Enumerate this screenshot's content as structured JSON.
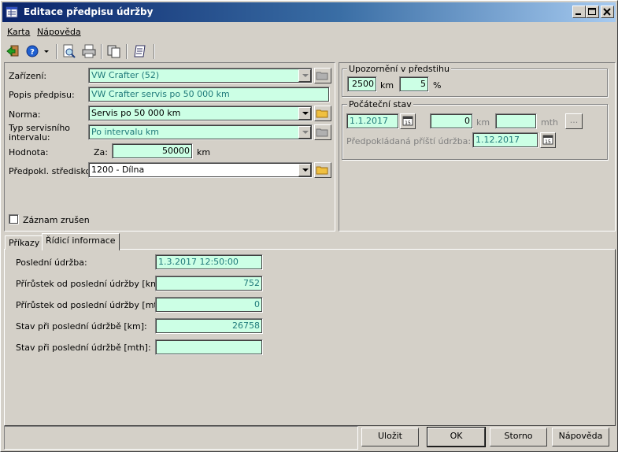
{
  "window": {
    "title": "Editace předpisu údržby"
  },
  "menu": {
    "items": [
      "Karta",
      "Nápověda"
    ]
  },
  "toolbar": {
    "icons": [
      "exit-icon",
      "help-icon",
      "dropdown-arrow-icon",
      "preview-icon",
      "print-icon",
      "copy-icon",
      "notes-icon"
    ]
  },
  "form": {
    "zarizeni": {
      "label": "Zařízení:",
      "value": "VW Crafter (52)"
    },
    "popis": {
      "label": "Popis předpisu:",
      "value": "VW Crafter servis po 50 000 km"
    },
    "norma": {
      "label": "Norma:",
      "value": "Servis po 50 000 km"
    },
    "typ": {
      "label_line1": "Typ servisního",
      "label_line2": "intervalu:",
      "value": "Po intervalu km"
    },
    "hodnota": {
      "label": "Hodnota:",
      "za_label": "Za:",
      "value": "50000",
      "unit": "km"
    },
    "stredisko": {
      "label": "Předpokl. středisko:",
      "value": "1200 - Dílna"
    },
    "zrusen": {
      "label": "Záznam zrušen",
      "checked": false
    }
  },
  "upozorneni": {
    "legend": "Upozornění v předstihu",
    "km_value": "2500",
    "km_unit": "km",
    "pct_value": "5",
    "pct_unit": "%"
  },
  "pocatecni": {
    "legend": "Počáteční stav",
    "date": "1.1.2017",
    "km_value": "0",
    "km_unit": "km",
    "mth_value": "",
    "mth_unit": "mth",
    "ellipsis": "...",
    "next_label": "Předpokládaná příští údržba:",
    "next_date": "1.12.2017"
  },
  "tabs": [
    {
      "label": "Příkazy"
    },
    {
      "label": "Řídicí informace"
    }
  ],
  "ridici": {
    "rows": [
      {
        "label": "Poslední údržba:",
        "value": "1.3.2017 12:50:00"
      },
      {
        "label": "Přírůstek od poslední údržby [km]:",
        "value": "752"
      },
      {
        "label": "Přírůstek od poslední údržby [mth]:",
        "value": "0"
      },
      {
        "label": "Stav při poslední údržbě [km]:",
        "value": "26758"
      },
      {
        "label": "Stav při poslední údržbě [mth]:",
        "value": ""
      }
    ]
  },
  "buttons": {
    "ulozit": "Uložit",
    "ok": "OK",
    "storno": "Storno",
    "napoveda": "Nápověda"
  },
  "colors": {
    "field_bg": "#ccffe5",
    "title_start": "#0a246a",
    "title_end": "#a6caf0",
    "face": "#d4d0c8"
  }
}
